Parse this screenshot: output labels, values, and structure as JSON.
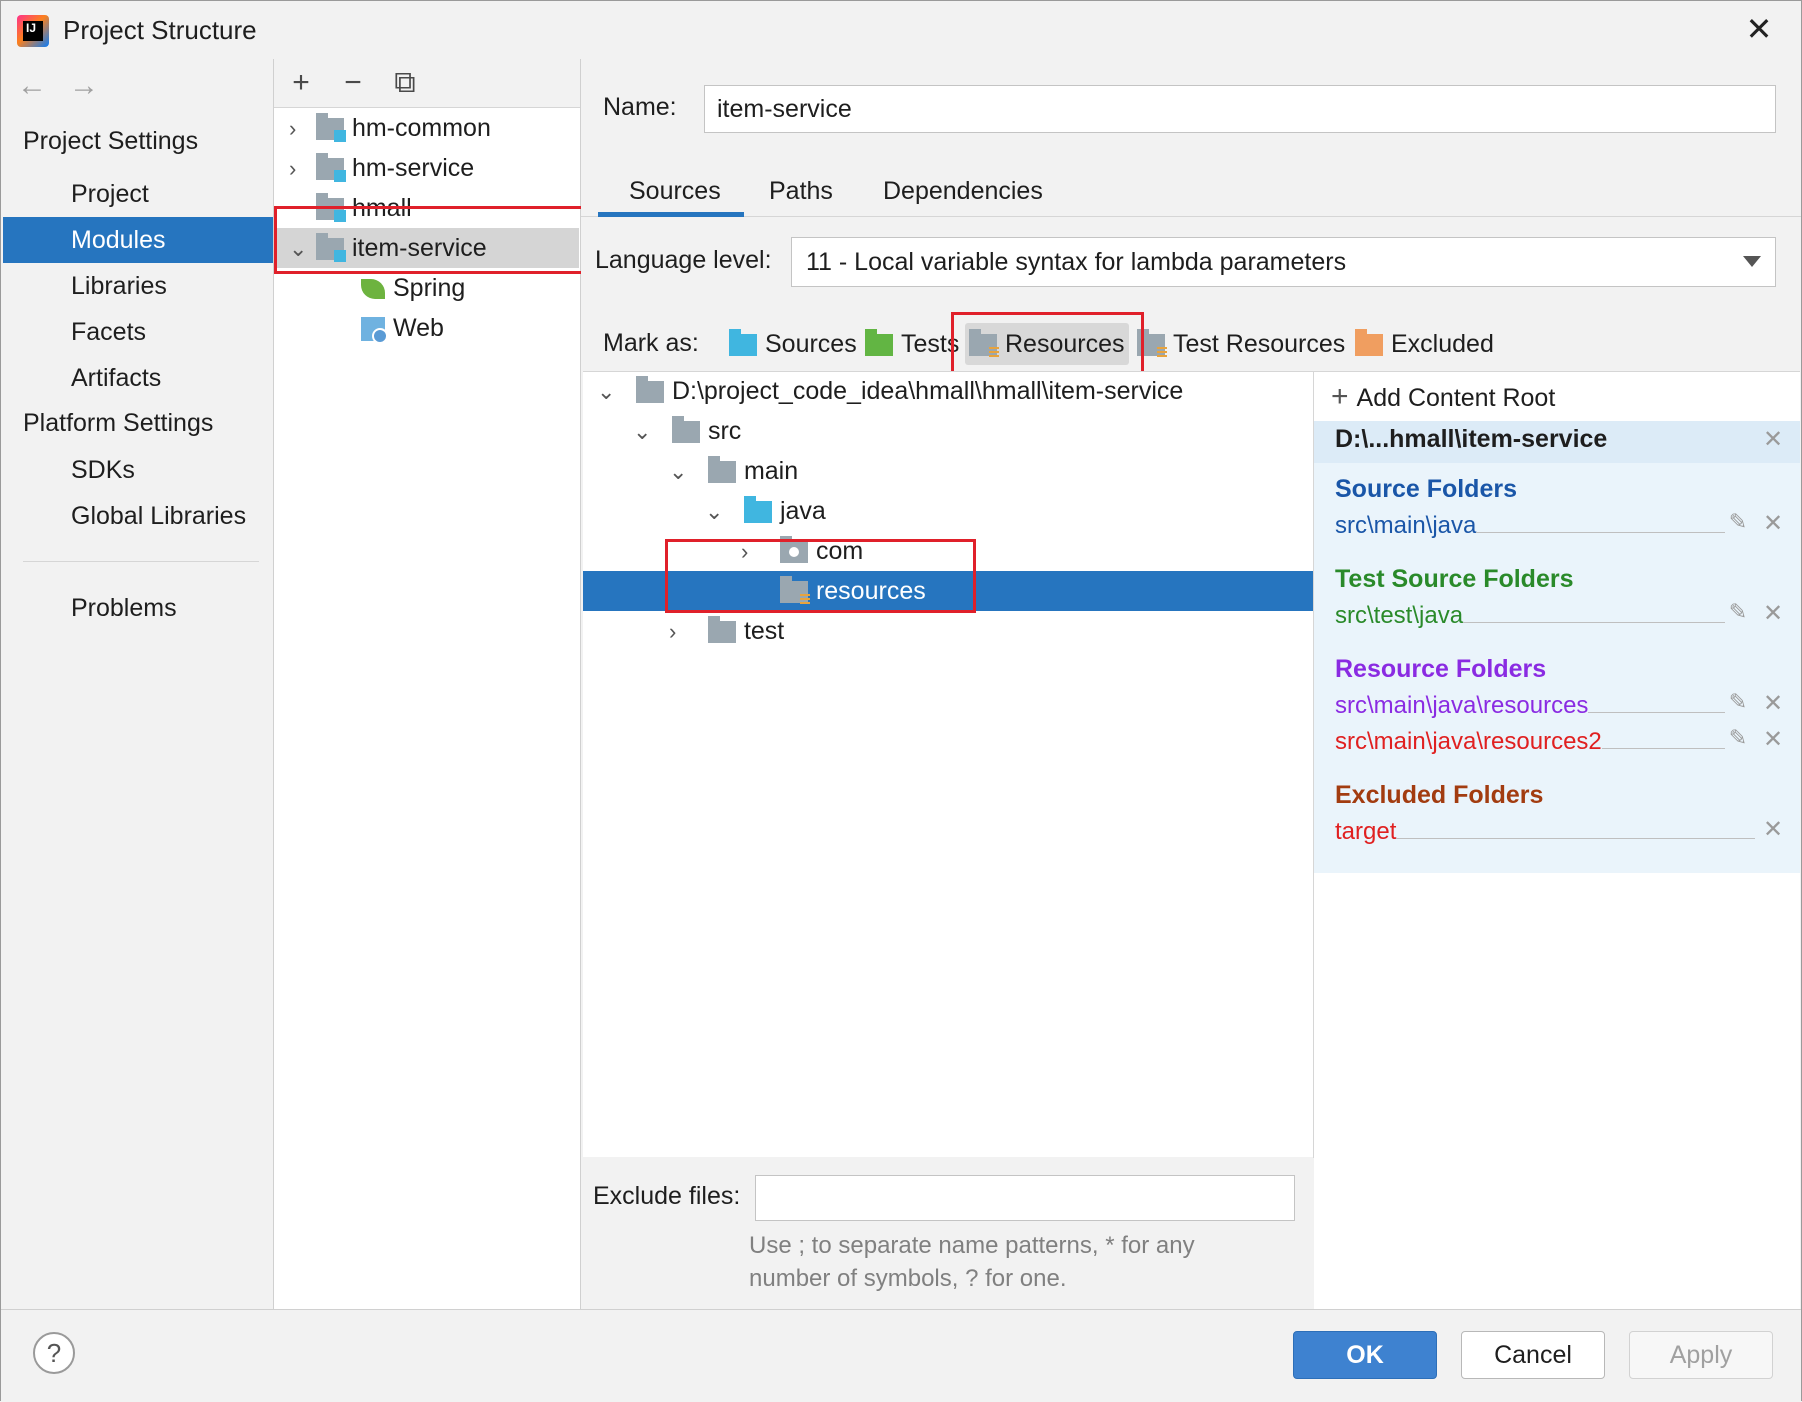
{
  "window": {
    "title": "Project Structure",
    "close_glyph": "✕"
  },
  "nav": {
    "back_glyph": "←",
    "forward_glyph": "→",
    "project_settings": "Project Settings",
    "items_top": [
      "Project",
      "Modules",
      "Libraries",
      "Facets",
      "Artifacts"
    ],
    "platform_settings": "Platform Settings",
    "items_platform": [
      "SDKs",
      "Global Libraries"
    ],
    "problems": "Problems",
    "selected": "Modules"
  },
  "modules": {
    "toolbar": {
      "add": "+",
      "remove": "−",
      "copy": "⧉"
    },
    "tree": [
      {
        "label": "hm-common",
        "expanded": false
      },
      {
        "label": "hm-service",
        "expanded": false
      },
      {
        "label": "hmall",
        "expanded": false
      },
      {
        "label": "item-service",
        "expanded": true,
        "selected": true
      },
      {
        "label": "Spring",
        "child": true
      },
      {
        "label": "Web",
        "child": true
      }
    ]
  },
  "module_detail": {
    "name_label": "Name:",
    "name_value": "item-service",
    "tabs": [
      "Sources",
      "Paths",
      "Dependencies"
    ],
    "active_tab": "Sources",
    "language_label": "Language level:",
    "language_value": "11 - Local variable syntax for lambda parameters",
    "mark_as_label": "Mark as:",
    "mark_as": [
      "Sources",
      "Tests",
      "Resources",
      "Test Resources",
      "Excluded"
    ],
    "dir_tree": [
      {
        "label": "D:\\project_code_idea\\hmall\\hmall\\item-service",
        "level": 0,
        "chevron": "⌄"
      },
      {
        "label": "src",
        "level": 1,
        "chevron": "⌄"
      },
      {
        "label": "main",
        "level": 2,
        "chevron": "⌄"
      },
      {
        "label": "java",
        "level": 3,
        "chevron": "⌄"
      },
      {
        "label": "com",
        "level": 4,
        "chevron": "›"
      },
      {
        "label": "resources",
        "level": 4,
        "chevron": "",
        "selected": true
      },
      {
        "label": "test",
        "level": 2,
        "chevron": "›"
      }
    ],
    "exclude_label": "Exclude files:",
    "exclude_hint_1": "Use ; to separate name patterns, * for any",
    "exclude_hint_2": "number of symbols, ? for one."
  },
  "content_root": {
    "add_label": "Add Content Root",
    "add_glyph": "+",
    "root_path": "D:\\...hmall\\item-service",
    "source_heading": "Source Folders",
    "source_folders": [
      "src\\main\\java"
    ],
    "test_heading": "Test Source Folders",
    "test_folders": [
      "src\\test\\java"
    ],
    "resource_heading": "Resource Folders",
    "resource_folders": [
      "src\\main\\java\\resources",
      "src\\main\\java\\resources2"
    ],
    "excluded_heading": "Excluded Folders",
    "excluded_folders": [
      "target"
    ],
    "remove_glyph": "✕",
    "edit_glyph": "✎"
  },
  "buttons": {
    "help": "?",
    "ok": "OK",
    "cancel": "Cancel",
    "apply": "Apply"
  },
  "colors": {
    "selection": "#2675bf",
    "source": "#1a56a8",
    "test": "#2a8a2a",
    "resource": "#8a2be2",
    "resource_error": "#e02020",
    "excluded": "#a23c10",
    "highlight_box": "#e0202a"
  }
}
